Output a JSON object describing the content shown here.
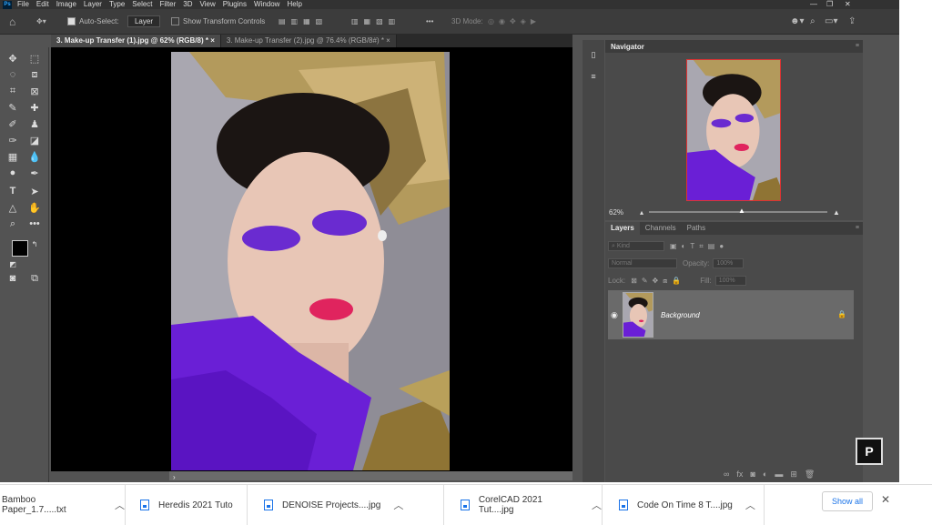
{
  "menu": [
    "File",
    "Edit",
    "Image",
    "Layer",
    "Type",
    "Select",
    "Filter",
    "3D",
    "View",
    "Plugins",
    "Window",
    "Help"
  ],
  "options": {
    "auto_select_label": "Auto-Select:",
    "layer_select": "Layer",
    "show_transform_label": "Show Transform Controls",
    "mode_3d_label": "3D Mode:"
  },
  "tabs": [
    {
      "label": "3. Make-up Transfer (1).jpg @ 62% (RGB/8) *"
    },
    {
      "label": "3. Make-up Transfer (2).jpg @ 76.4% (RGB/8#) *"
    }
  ],
  "navigator": {
    "title": "Navigator",
    "zoom": "62%"
  },
  "layers_panel": {
    "tabs": [
      "Layers",
      "Channels",
      "Paths"
    ],
    "kind_label": "Kind",
    "blend_mode": "Normal",
    "opacity_label": "Opacity:",
    "opacity_value": "100%",
    "lock_label": "Lock:",
    "fill_label": "Fill:",
    "fill_value": "100%",
    "layer_name": "Background"
  },
  "scrollbar_arrow": "›",
  "downloads": {
    "items": [
      {
        "name": "Bamboo Paper_1.7.....txt"
      },
      {
        "name": "Heredis 2021 Tuto"
      },
      {
        "name": "DENOISE Projects....jpg"
      },
      {
        "name": "CorelCAD 2021 Tut....jpg"
      },
      {
        "name": "Code On Time 8 T....jpg"
      }
    ],
    "show_all": "Show all"
  },
  "colors": {
    "accent": "#1a73e8",
    "purple": "#6a1fd6",
    "gold": "#b9a05a"
  }
}
